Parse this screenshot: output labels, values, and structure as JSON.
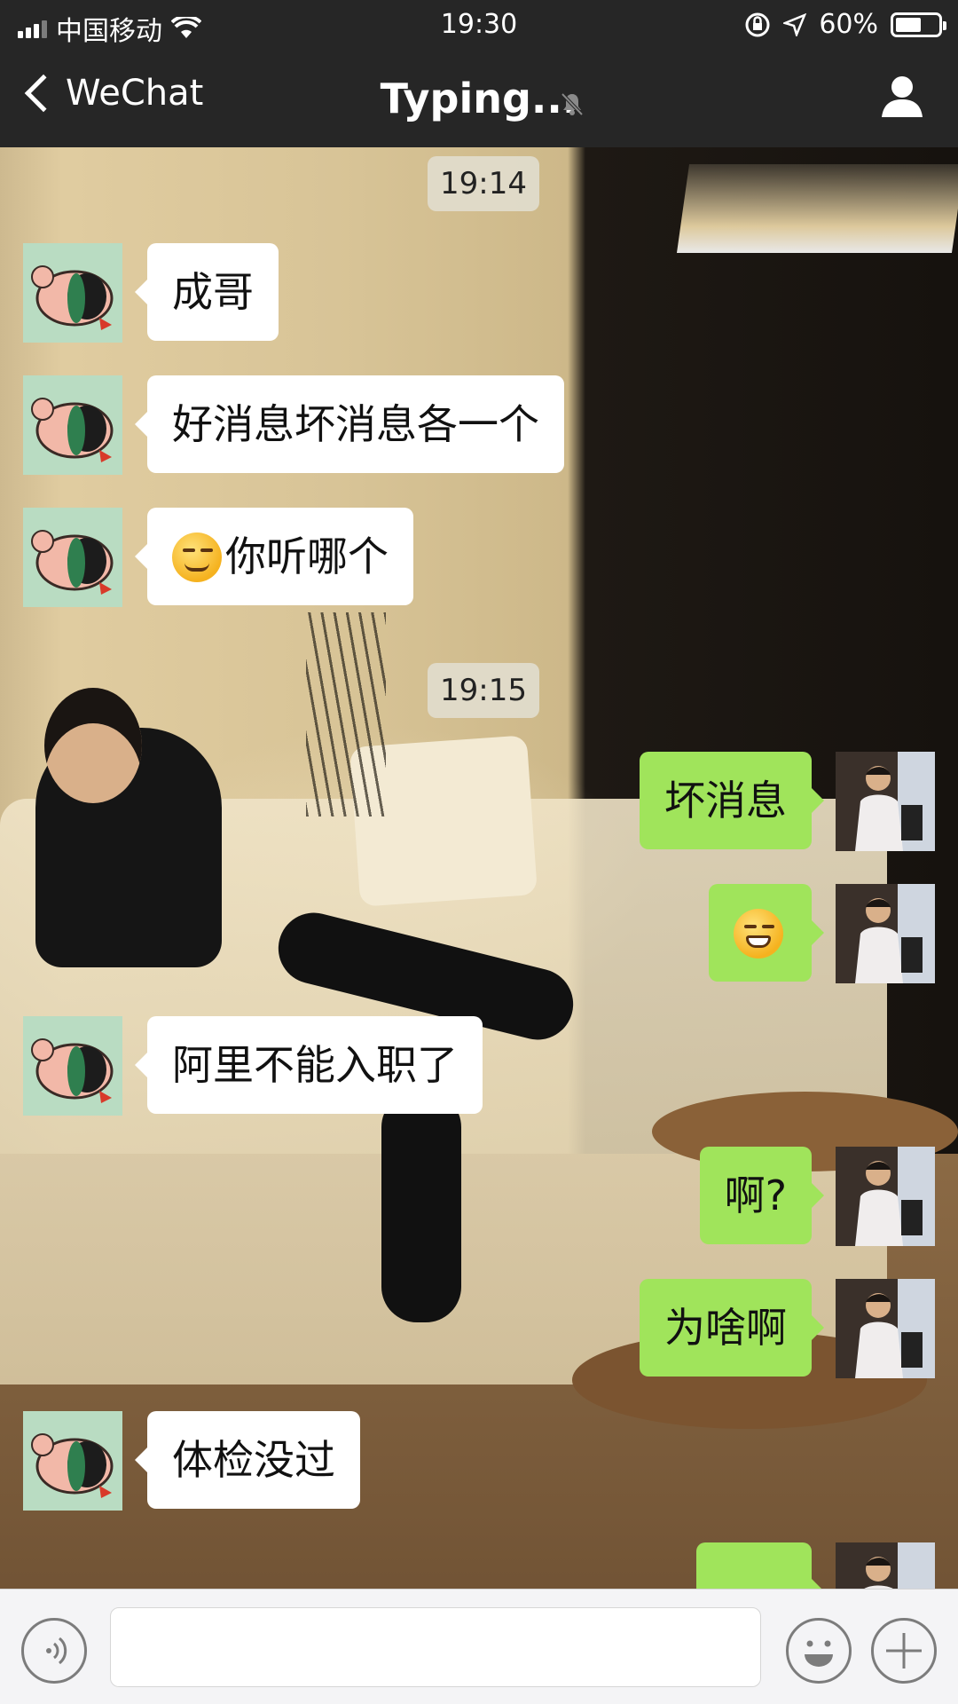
{
  "status_bar": {
    "carrier": "中国移动",
    "time": "19:30",
    "battery": "60%",
    "battery_level": 0.6
  },
  "nav": {
    "back_label": "WeChat",
    "title": "Typing...",
    "muted": true
  },
  "chat": {
    "timestamps": [
      "19:14",
      "19:15"
    ],
    "messages": [
      {
        "side": "left",
        "text": "成哥"
      },
      {
        "side": "left",
        "text": "好消息坏消息各一个"
      },
      {
        "side": "left",
        "emoji": "smirk-emoji",
        "text": "你听哪个"
      },
      {
        "side": "right",
        "text": "坏消息"
      },
      {
        "side": "right",
        "emoji": "grin-emoji",
        "text": ""
      },
      {
        "side": "left",
        "text": "阿里不能入职了"
      },
      {
        "side": "right",
        "text": "啊?"
      },
      {
        "side": "right",
        "text": "为啥啊"
      },
      {
        "side": "left",
        "text": "体检没过"
      },
      {
        "side": "right",
        "text": ""
      }
    ]
  },
  "input_bar": {
    "voice_icon": "voice-icon",
    "emoji_icon": "emoji-icon",
    "plus_icon": "plus-icon",
    "text_value": ""
  },
  "colors": {
    "nav_bg": "#262626",
    "sent_bubble": "#a0e45b",
    "received_bubble": "#ffffff"
  }
}
